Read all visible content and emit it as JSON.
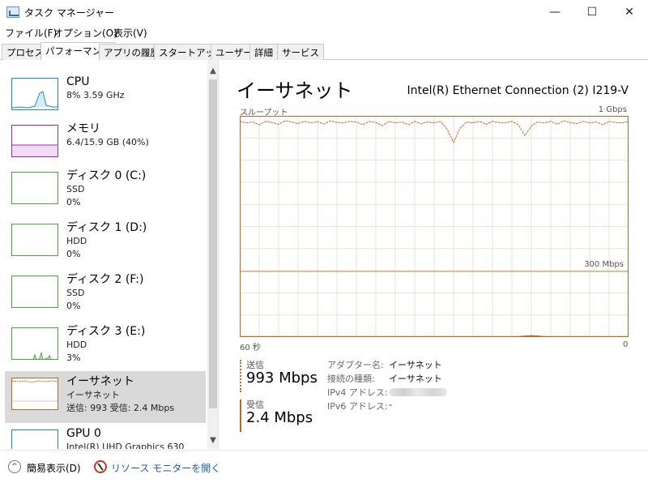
{
  "window": {
    "title": "タスク マネージャー",
    "minimize": "—",
    "maximize": "☐",
    "close": "✕"
  },
  "menu": [
    "ファイル(F)",
    "オプション(O)",
    "表示(V)"
  ],
  "tabs": [
    "プロセス",
    "パフォーマンス",
    "アプリの履歴",
    "スタートアップ",
    "ユーザー",
    "詳細",
    "サービス"
  ],
  "active_tab": "パフォーマンス",
  "sidebar": {
    "items": [
      {
        "title": "CPU",
        "sub1": "8%  3.59 GHz",
        "sub2": "",
        "color": "#1a8ad4"
      },
      {
        "title": "メモリ",
        "sub1": "6.4/15.9 GB (40%)",
        "sub2": "",
        "color": "#9b2fae"
      },
      {
        "title": "ディスク 0 (C:)",
        "sub1": "SSD",
        "sub2": "0%",
        "color": "#4da33d"
      },
      {
        "title": "ディスク 1 (D:)",
        "sub1": "HDD",
        "sub2": "0%",
        "color": "#4da33d"
      },
      {
        "title": "ディスク 2 (F:)",
        "sub1": "SSD",
        "sub2": "0%",
        "color": "#4da33d"
      },
      {
        "title": "ディスク 3 (E:)",
        "sub1": "HDD",
        "sub2": "3%",
        "color": "#4da33d"
      },
      {
        "title": "イーサネット",
        "sub1": "イーサネット",
        "sub2": "送信: 993 受信: 2.4 Mbps",
        "color": "#b46b2a"
      },
      {
        "title": "GPU 0",
        "sub1": "Intel(R) UHD Graphics 630",
        "sub2": "",
        "color": "#1a8ad4"
      }
    ],
    "scroll_up": "▲",
    "scroll_down": "▼"
  },
  "main": {
    "title": "イーサネット",
    "adapter": "Intel(R) Ethernet Connection (2) I219-V",
    "chart_top_left": "スループット",
    "chart_top_right": "1 Gbps",
    "chart_mid_right": "300 Mbps",
    "chart_bottom_left": "60 秒",
    "chart_bottom_right": "0"
  },
  "chart_data": {
    "type": "line",
    "title": "スループット",
    "xlabel": "60 秒",
    "ylabel": "",
    "ylim": [
      0,
      1000
    ],
    "series": [
      {
        "name": "送信",
        "values": [
          975,
          968,
          972,
          960,
          975,
          970,
          962,
          978,
          972,
          965,
          975,
          968,
          974,
          963,
          978,
          970,
          968,
          975,
          972,
          960,
          975,
          970,
          955,
          975,
          968,
          972,
          960,
          975,
          965,
          972,
          968,
          975,
          940,
          880,
          945,
          972,
          968,
          975,
          962,
          975,
          970,
          968,
          975,
          960,
          910,
          955,
          972,
          968,
          975,
          962,
          978,
          970,
          965,
          975,
          968,
          972,
          960,
          975,
          970,
          968,
          975
        ]
      },
      {
        "name": "受信",
        "values": [
          2,
          2,
          2,
          2,
          2,
          2,
          2,
          2,
          2,
          2,
          2,
          2,
          2,
          2,
          2,
          2,
          2,
          2,
          2,
          2,
          2,
          2,
          2,
          2,
          2,
          2,
          2,
          2,
          2,
          2,
          2,
          2,
          2,
          2,
          2,
          2,
          2,
          2,
          2,
          2,
          2,
          2,
          2,
          2,
          4,
          6,
          4,
          2,
          2,
          2,
          2,
          2,
          2,
          2,
          2,
          2,
          2,
          2,
          2,
          2,
          2
        ]
      }
    ],
    "grid": true
  },
  "stats": {
    "send_label": "送信",
    "send_value": "993 Mbps",
    "recv_label": "受信",
    "recv_value": "2.4 Mbps"
  },
  "properties": [
    {
      "key": "アダプター名:",
      "value": "イーサネット"
    },
    {
      "key": "接続の種類:",
      "value": "イーサネット"
    },
    {
      "key": "IPv4 アドレス:",
      "value": ""
    },
    {
      "key": "IPv6 アドレス:",
      "value": "-"
    }
  ],
  "footer": {
    "collapse_label": "簡易表示(D)",
    "collapse_icon": "^",
    "resource_monitor_label": "リソース モニターを開く"
  }
}
